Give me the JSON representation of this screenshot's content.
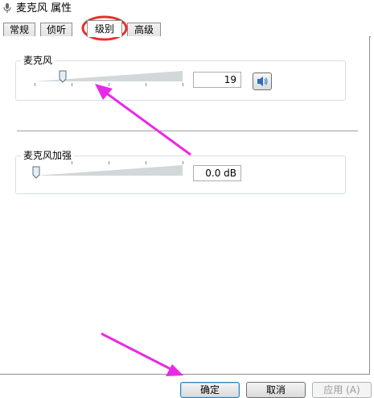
{
  "window": {
    "title": "麦克风 属性",
    "icon": "microphone-icon"
  },
  "tabs": [
    {
      "label": "常规",
      "active": false
    },
    {
      "label": "侦听",
      "active": false
    },
    {
      "label": "级别",
      "active": true
    },
    {
      "label": "高级",
      "active": false
    }
  ],
  "microphone": {
    "group_title": "麦克风",
    "level": 19,
    "value_text": "19",
    "speaker_icon": "speaker-icon"
  },
  "boost": {
    "group_title": "麦克风加强",
    "value_text": "0.0 dB"
  },
  "buttons": {
    "ok": "确定",
    "cancel": "取消",
    "apply": "应用 (A)"
  },
  "annotations": {
    "highlight_color": "#e5322d",
    "arrow_color": "#e82ae8"
  }
}
